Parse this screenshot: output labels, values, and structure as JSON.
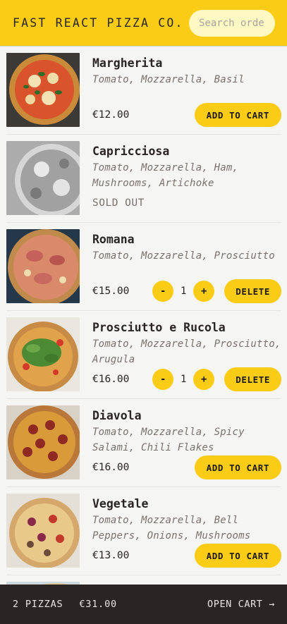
{
  "header": {
    "logo": "FAST REACT PIZZA CO.",
    "search_placeholder": "Search order #"
  },
  "menu": [
    {
      "name": "Margherita",
      "ingredients": "Tomato, Mozzarella, Basil",
      "price": "€12.00",
      "sold_out": false,
      "in_cart": false,
      "button": "ADD TO CART"
    },
    {
      "name": "Capricciosa",
      "ingredients": "Tomato, Mozzarella, Ham, Mushrooms, Artichoke",
      "status": "SOLD OUT",
      "sold_out": true
    },
    {
      "name": "Romana",
      "ingredients": "Tomato, Mozzarella, Prosciutto",
      "price": "€15.00",
      "in_cart": true,
      "quantity": "1",
      "minus": "-",
      "plus": "+",
      "button": "DELETE"
    },
    {
      "name": "Prosciutto e Rucola",
      "ingredients": "Tomato, Mozzarella, Prosciutto, Arugula",
      "price": "€16.00",
      "in_cart": true,
      "quantity": "1",
      "minus": "-",
      "plus": "+",
      "button": "DELETE"
    },
    {
      "name": "Diavola",
      "ingredients": "Tomato, Mozzarella, Spicy Salami, Chili Flakes",
      "price": "€16.00",
      "in_cart": false,
      "button": "ADD TO CART"
    },
    {
      "name": "Vegetale",
      "ingredients": "Tomato, Mozzarella, Bell Peppers, Onions, Mushrooms",
      "price": "€13.00",
      "in_cart": false,
      "button": "ADD TO CART"
    }
  ],
  "footer": {
    "count": "2 PIZZAS",
    "total": "€31.00",
    "open_cart": "OPEN CART →"
  },
  "colors": {
    "accent": "#facc15",
    "footer_bg": "#292524",
    "page_bg": "#f5f5f4"
  }
}
